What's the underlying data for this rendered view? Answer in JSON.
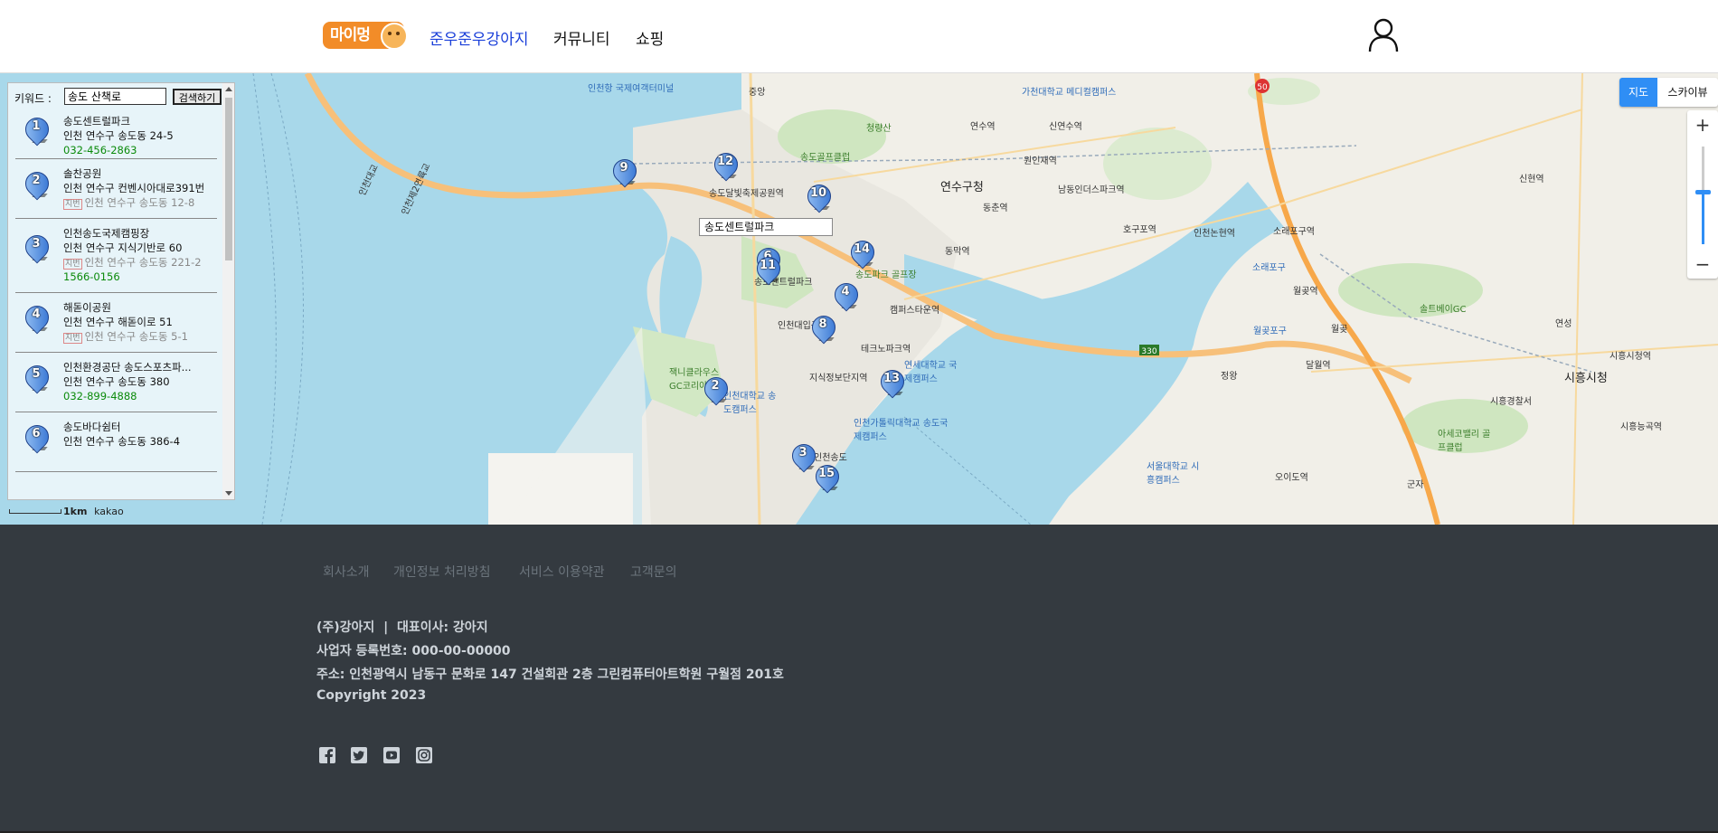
{
  "header": {
    "logo_text": "마이멍",
    "nav": [
      {
        "label": "준우준우강아지",
        "active": true
      },
      {
        "label": "커뮤니티",
        "active": false
      },
      {
        "label": "쇼핑",
        "active": false
      }
    ],
    "user_icon": "user-icon"
  },
  "map": {
    "search": {
      "label": "키워드 :",
      "value": "송도 산책로",
      "button": "검색하기"
    },
    "places": [
      {
        "num": "1",
        "name": "송도센트럴파크",
        "address": "인천 연수구 송도동 24-5",
        "jibun": "",
        "tel": "032-456-2863"
      },
      {
        "num": "2",
        "name": "솔찬공원",
        "address": "인천 연수구 컨벤시아대로391번",
        "jibun": "인천 연수구 송도동 12-8",
        "tel": ""
      },
      {
        "num": "3",
        "name": "인천송도국제캠핑장",
        "address": "인천 연수구 지식기반로 60",
        "jibun": "인천 연수구 송도동 221-2",
        "tel": "1566-0156"
      },
      {
        "num": "4",
        "name": "해돋이공원",
        "address": "인천 연수구 해돋이로 51",
        "jibun": "인천 연수구 송도동 5-1",
        "tel": ""
      },
      {
        "num": "5",
        "name": "인천환경공단 송도스포츠파...",
        "address": "인천 연수구 송도동 380",
        "jibun": "",
        "tel": "032-899-4888"
      },
      {
        "num": "6",
        "name": "송도바다쉼터",
        "address": "인천 연수구 송도동 386-4",
        "jibun": "",
        "tel": ""
      }
    ],
    "jibun_tag": "지번",
    "tooltip": "송도센트럴파크",
    "map_type": {
      "map": "지도",
      "skyview": "스카이뷰"
    },
    "zoom": {
      "plus": "+",
      "minus": "−"
    },
    "scale": "1km",
    "brand": "kakao",
    "markers": [
      "9",
      "12",
      "10",
      "14",
      "6",
      "11",
      "4",
      "8",
      "2",
      "13",
      "3",
      "15"
    ],
    "labels": {
      "yeonsu_gu": "연수구청",
      "siheung_si": "시흥시청",
      "songdo_cp": "송도센트럴파크",
      "incheon_port": "인천항 국제여객터미널",
      "gachon": "가천대학교 메디컬캠퍼스",
      "cheongnyang": "청량산",
      "wonin": "원인재역",
      "yeonsu_st": "연수역",
      "sinyeonsu": "신연수역",
      "songdo_golf": "송도골프클럽",
      "namdong": "남동인더스파크역",
      "dongchun": "동춘역",
      "homang": "호구포역",
      "incheon_nonhyeon": "인천논현역",
      "sorae": "소래포구역",
      "sorae_port": "소래포구",
      "dongmak": "동막역",
      "songdo_park_golf": "송도파크 골프장",
      "campus_town": "캠퍼스타운역",
      "univ_entrance": "인천대입구역",
      "techno_park": "테크노파크역",
      "yonsei": "연세대학교 국제캠퍼스",
      "jisik": "지식정보단지역",
      "catholic": "인천가톨릭대학교 송도국제캠퍼스",
      "incheon_univ": "인천대학교 송도캠퍼스",
      "jack_nicklaus": "잭니클라우스 GC코리아",
      "songdo_dal": "송도달빛축제공원역",
      "incheon_songdo": "인천송도",
      "seoul_univ": "서울대학교 시흥캠퍼스",
      "oido": "오이도역",
      "wolgot": "월곶역",
      "wolgot_port": "월곶포구",
      "dalwol": "달월역",
      "solteu": "솔트베이GC",
      "siheung_police": "시흥경찰서",
      "asegovalley": "아세코밸리 골프클럽",
      "siheung_sicheong_st": "시흥시청역",
      "sinhyeon": "신현역",
      "siheung_neunggok": "시흥능곡역",
      "yeonseong": "연성",
      "jeongwang": "정왕",
      "gunja": "군자",
      "wolgot_ic": "월곶",
      "jungang": "중앙",
      "route_50": "50",
      "route_330": "330",
      "incheon_bridge_a": "인천대교",
      "incheon_bridge_b": "인천제2연륙교"
    }
  },
  "footer": {
    "links": [
      "회사소개",
      "개인정보 처리방침",
      "서비스 이용약관",
      "고객문의"
    ],
    "company": "(주)강아지",
    "ceo": "대표이사: 강아지",
    "biz_no": "사업자 등록번호: 000-00-00000",
    "address": "주소: 인천광역시 남동구 문화로 147 건설회관 2층 그린컴퓨터아트학원 구월점 201호",
    "copyright": "Copyright 2023",
    "social": [
      "facebook-icon",
      "twitter-icon",
      "youtube-icon",
      "instagram-icon"
    ]
  },
  "colors": {
    "accent": "#2f8ef5",
    "nav_active": "#1a3fd9",
    "footer_bg": "#343a40",
    "logo": "#f28c28",
    "water": "#a8d8ea",
    "tel": "#0a8a0a"
  }
}
